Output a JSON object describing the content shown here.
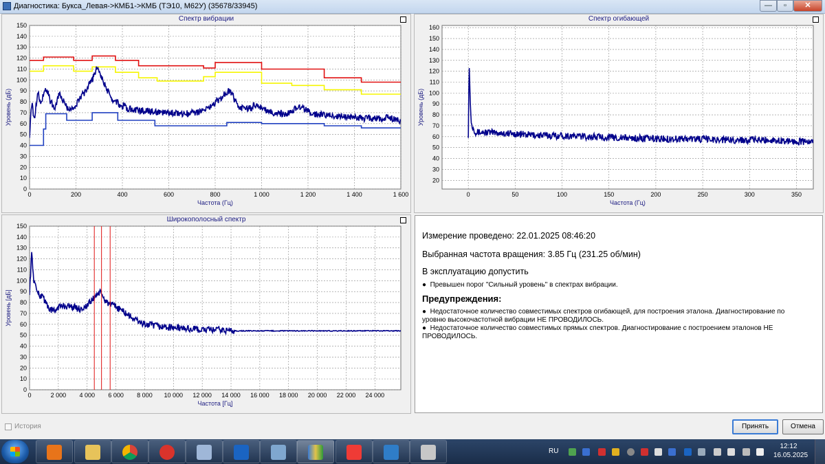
{
  "window": {
    "title": "Диагностика: Букса_Левая->КМБ1->КМБ (ТЭ10, М62У) (35678/33945)",
    "controls": {
      "minimize": "—",
      "maximize": "▫",
      "close": "✕"
    }
  },
  "colors": {
    "spectrum": "#00008b",
    "threshold_high": "#e01010",
    "threshold_mid": "#f5f500",
    "threshold_low": "#2040c0",
    "markers": "#e01010",
    "grid": "#888888"
  },
  "chart_data": [
    {
      "type": "line",
      "title": "Спектр вибрации",
      "xlabel": "Частота (Гц)",
      "ylabel": "Уровень (дБ)",
      "xlim": [
        0,
        1600
      ],
      "ylim": [
        0,
        150
      ],
      "xticks": [
        0,
        200,
        400,
        600,
        800,
        1000,
        1200,
        1400,
        1600
      ],
      "xtick_labels": [
        "0",
        "200",
        "400",
        "600",
        "800",
        "1 000",
        "1 200",
        "1 400",
        "1 600"
      ],
      "yticks": [
        0,
        10,
        20,
        30,
        40,
        50,
        60,
        70,
        80,
        90,
        100,
        110,
        120,
        130,
        140,
        150
      ],
      "grid": true,
      "series": [
        {
          "color": "#e01010",
          "kind": "step",
          "x": [
            0,
            60,
            60,
            190,
            190,
            270,
            270,
            370,
            370,
            470,
            470,
            750,
            750,
            800,
            800,
            1000,
            1000,
            1270,
            1270,
            1430,
            1430,
            1600
          ],
          "y": [
            118,
            118,
            121,
            121,
            118,
            118,
            122,
            122,
            118,
            118,
            113,
            113,
            111,
            111,
            116,
            116,
            110,
            110,
            102,
            102,
            98,
            98
          ]
        },
        {
          "color": "#f5f500",
          "kind": "step",
          "x": [
            0,
            60,
            60,
            190,
            190,
            270,
            270,
            370,
            370,
            470,
            470,
            550,
            550,
            750,
            750,
            800,
            800,
            1000,
            1000,
            1130,
            1130,
            1270,
            1270,
            1430,
            1430,
            1600
          ],
          "y": [
            108,
            108,
            113,
            113,
            108,
            108,
            112,
            112,
            107,
            107,
            102,
            102,
            99,
            99,
            103,
            103,
            107,
            107,
            97,
            97,
            95,
            95,
            91,
            91,
            87,
            87
          ]
        },
        {
          "color": "#2040c0",
          "kind": "step",
          "x": [
            0,
            60,
            60,
            70,
            70,
            160,
            160,
            270,
            270,
            380,
            380,
            540,
            540,
            850,
            850,
            1000,
            1000,
            1270,
            1270,
            1430,
            1430,
            1600
          ],
          "y": [
            40,
            40,
            55,
            55,
            69,
            69,
            63,
            63,
            70,
            70,
            63,
            63,
            58,
            58,
            61,
            61,
            60,
            60,
            58,
            58,
            56,
            56
          ]
        },
        {
          "color": "#00008b",
          "kind": "noisy",
          "x": [
            0,
            10,
            20,
            35,
            50,
            60,
            75,
            90,
            110,
            130,
            150,
            175,
            200,
            225,
            250,
            270,
            285,
            295,
            310,
            330,
            360,
            400,
            440,
            480,
            520,
            560,
            600,
            640,
            680,
            720,
            760,
            790,
            820,
            845,
            860,
            875,
            890,
            920,
            950,
            980,
            1000,
            1030,
            1060,
            1100,
            1130,
            1160,
            1180,
            1210,
            1250,
            1300,
            1350,
            1400,
            1450,
            1500,
            1550,
            1600
          ],
          "y": [
            50,
            80,
            62,
            90,
            78,
            88,
            92,
            80,
            75,
            88,
            78,
            72,
            77,
            85,
            93,
            100,
            108,
            113,
            103,
            92,
            82,
            76,
            73,
            72,
            71,
            70,
            70,
            69,
            69,
            70,
            73,
            77,
            83,
            88,
            90,
            86,
            79,
            73,
            74,
            78,
            74,
            71,
            70,
            69,
            71,
            76,
            74,
            70,
            68,
            67,
            67,
            66,
            65,
            65,
            65,
            63
          ]
        }
      ]
    },
    {
      "type": "line",
      "title": "Спектр огибающей",
      "xlabel": "Частота (Гц)",
      "ylabel": "Уровень (дБ)",
      "xlim": [
        -28,
        368
      ],
      "ylim": [
        12,
        162
      ],
      "xticks": [
        0,
        50,
        100,
        150,
        200,
        250,
        300,
        350
      ],
      "xtick_labels": [
        "0",
        "50",
        "100",
        "150",
        "200",
        "250",
        "300",
        "350"
      ],
      "yticks": [
        20,
        30,
        40,
        50,
        60,
        70,
        80,
        90,
        100,
        110,
        120,
        130,
        140,
        150,
        160
      ],
      "grid": true,
      "series": [
        {
          "color": "#00008b",
          "kind": "noisy",
          "x": [
            0,
            0.8,
            3,
            8,
            20,
            40,
            60,
            80,
            100,
            130,
            160,
            200,
            240,
            280,
            320,
            368
          ],
          "y": [
            62,
            128,
            72,
            64,
            64,
            63,
            62,
            61,
            61,
            60,
            59,
            58,
            58,
            57,
            57,
            55
          ]
        }
      ]
    },
    {
      "type": "line",
      "title": "Широкополосный спектр",
      "xlabel": "Частота [Гц]",
      "ylabel": "Уровень [дБ]",
      "xlim": [
        0,
        25800
      ],
      "ylim": [
        0,
        150
      ],
      "xticks": [
        0,
        2000,
        4000,
        6000,
        8000,
        10000,
        12000,
        14000,
        16000,
        18000,
        20000,
        22000,
        24000
      ],
      "xtick_labels": [
        "0",
        "2 000",
        "4 000",
        "6 000",
        "8 000",
        "10 000",
        "12 000",
        "14 000",
        "16 000",
        "18 000",
        "20 000",
        "22 000",
        "24 000"
      ],
      "yticks": [
        0,
        10,
        20,
        30,
        40,
        50,
        60,
        70,
        80,
        90,
        100,
        110,
        120,
        130,
        140,
        150
      ],
      "grid": true,
      "vlines": [
        4500,
        5000,
        5600
      ],
      "series": [
        {
          "color": "#00008b",
          "kind": "noisy",
          "x": [
            0,
            150,
            300,
            500,
            700,
            900,
            1100,
            1400,
            1700,
            2000,
            2500,
            3000,
            3500,
            4000,
            4400,
            4700,
            4900,
            5200,
            5600,
            6000,
            6500,
            7000,
            7500,
            8000,
            9000,
            10000,
            11000,
            12000,
            13000,
            14000,
            15000,
            16000,
            18000,
            20000,
            22000,
            24000,
            25800
          ],
          "y": [
            90,
            125,
            100,
            92,
            85,
            88,
            80,
            74,
            72,
            76,
            77,
            76,
            74,
            77,
            83,
            88,
            89,
            83,
            78,
            76,
            72,
            67,
            63,
            60,
            58,
            57,
            56,
            55,
            55,
            54,
            54,
            54,
            54,
            54,
            54,
            54,
            54
          ]
        }
      ]
    }
  ],
  "info": {
    "measured": "Измерение проведено: 22.01.2025 08:46:20",
    "speed": "Выбранная частота вращения: 3.85 Гц  (231.25 об/мин)",
    "verdict": "В эксплуатацию допустить",
    "verdict_bullet": "Превышен порог \"Сильный уровень\" в спектрах вибрации.",
    "warnings_title": "Предупреждения:",
    "warning1": "Недостаточное количество совместимых спектров огибающей, для построения эталона. Диагностирование по уровню высокочастотной вибрации НЕ ПРОВОДИЛОСЬ.",
    "warning2": "Недостаточное количество совместимых прямых спектров. Диагностирование с построением эталонов НЕ ПРОВОДИЛОСЬ.",
    "bullet": "●"
  },
  "footer": {
    "history_label": "История",
    "history_checked": false,
    "accept_label": "Принять",
    "cancel_label": "Отмена"
  },
  "taskbar": {
    "apps": [
      "media-player-icon",
      "file-manager-icon",
      "chrome-icon",
      "ccleaner-icon",
      "database-icon",
      "outlook-icon",
      "calculator-icon",
      "diagnostics-app-icon",
      "anydesk-icon",
      "scanner-icon",
      "tools-icon"
    ],
    "language": "RU",
    "time": "12:12",
    "date": "16.05.2025"
  }
}
